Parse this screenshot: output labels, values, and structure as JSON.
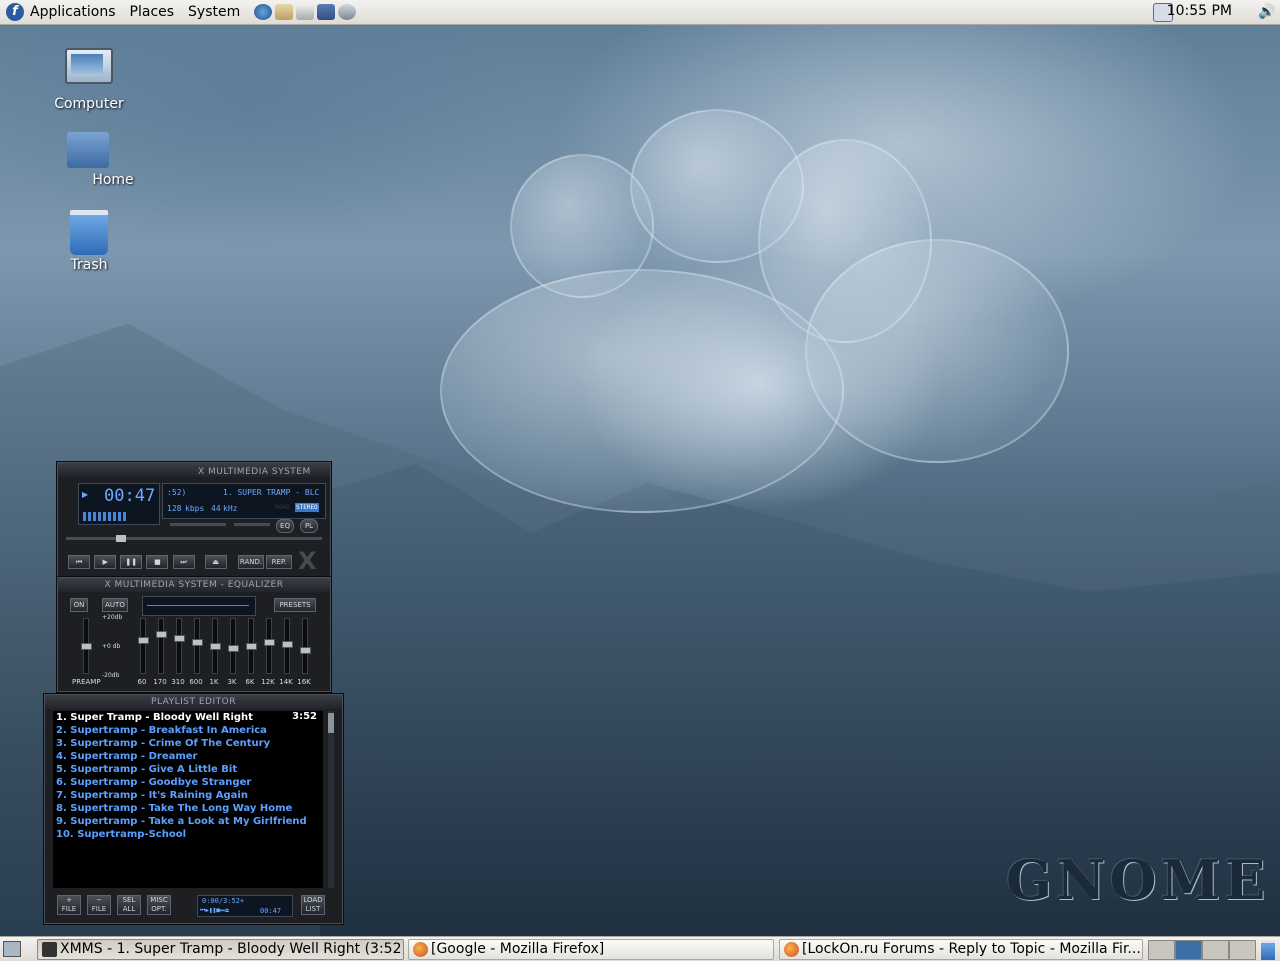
{
  "top_panel": {
    "menus": [
      "Applications",
      "Places",
      "System"
    ],
    "launchers": [
      "browser-icon",
      "mail-icon",
      "notes-icon",
      "text-editor-icon",
      "sound-icon"
    ],
    "clock": "10:55 PM"
  },
  "desktop": {
    "icons": [
      {
        "label": "Computer"
      },
      {
        "label": "Home"
      },
      {
        "label": "Trash"
      }
    ],
    "wallpaper_logo": "GNOME"
  },
  "xmms": {
    "main": {
      "title": "X MULTIMEDIA SYSTEM",
      "time": "00:47",
      "track_number": ":52)",
      "marquee": "1. SUPER TRAMP - BLC",
      "bitrate": "128",
      "bitrate_unit": "kbps",
      "samplerate": "44",
      "samplerate_unit": "kHz",
      "mono": "MONO",
      "stereo": "STEREO",
      "eq_toggle": "EQ",
      "pl_toggle": "PL",
      "shuffle": "RAND.",
      "repeat": "REP."
    },
    "equalizer": {
      "title": "X MULTIMEDIA SYSTEM - EQUALIZER",
      "on_label": "ON",
      "auto_label": "AUTO",
      "presets_label": "PRESETS",
      "db_top": "+20db",
      "db_mid": "+0 db",
      "db_bottom": "-20db",
      "preamp_label": "PREAMP",
      "bands": [
        "60",
        "170",
        "310",
        "600",
        "1K",
        "3K",
        "6K",
        "12K",
        "14K",
        "16K"
      ]
    },
    "playlist": {
      "title": "PLAYLIST EDITOR",
      "current_time": "3:52",
      "tracks": [
        "1. Super Tramp - Bloody Well Right",
        "2. Supertramp - Breakfast In America",
        "3. Supertramp - Crime Of The Century",
        "4. Supertramp - Dreamer",
        "5. Supertramp - Give A Little Bit",
        "6. Supertramp - Goodbye Stranger",
        "7. Supertramp - It's Raining Again",
        "8. Supertramp - Take The Long Way Home",
        "9. Supertramp - Take a Look at My Girlfriend",
        "10. Supertramp-School"
      ],
      "buttons": {
        "add": "FILE",
        "remove": "FILE",
        "select": "SEL ALL",
        "misc": "MISC OPT.",
        "list": "LOAD LIST"
      },
      "position": "0:00/3:52+",
      "elapsed": "00:47"
    }
  },
  "taskbar": {
    "tasks": [
      {
        "label": "XMMS - 1. Super Tramp - Bloody Well Right (3:52)"
      },
      {
        "label": "[Google - Mozilla Firefox]"
      },
      {
        "label": "[LockOn.ru Forums - Reply to Topic - Mozilla Fir..."
      }
    ]
  },
  "colors": {
    "panel_bg": "#dedcd7",
    "xmms_bg": "#1d1f22",
    "playlist_text": "#5aa0ff",
    "playlist_current": "#ffffff",
    "workspace_active": "#3c6ea8"
  }
}
